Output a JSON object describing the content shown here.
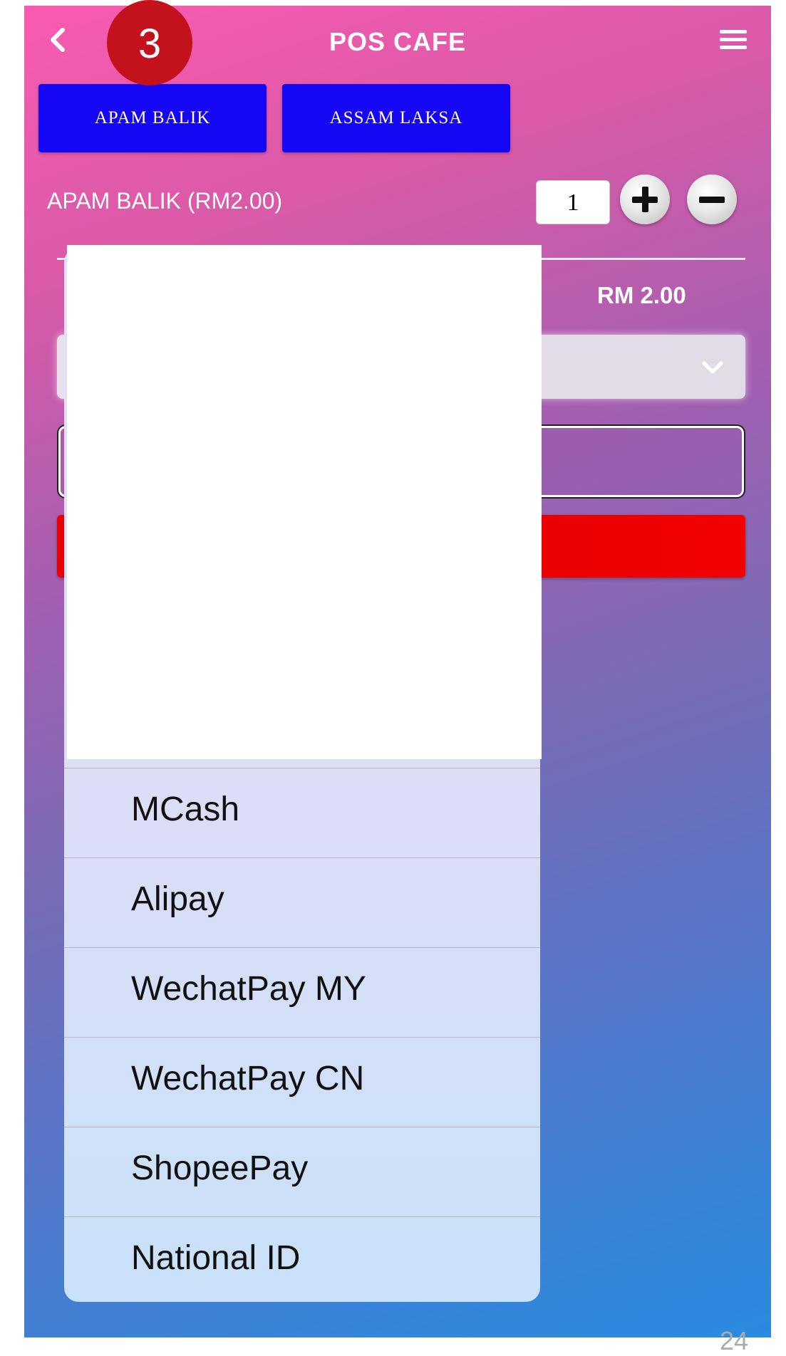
{
  "header": {
    "title": "POS CAFE",
    "back_icon": "chevron-left-icon",
    "menu_icon": "hamburger-menu-icon"
  },
  "step_badge": "3",
  "menu_items": [
    {
      "label": "APAM BALIK"
    },
    {
      "label": "ASSAM LAKSA"
    }
  ],
  "order": {
    "selected_item": "APAM BALIK (RM2.00)",
    "quantity": "1",
    "total": "RM 2.00"
  },
  "payment_dropdown": {
    "options": [
      {
        "label": "MCash"
      },
      {
        "label": "Alipay"
      },
      {
        "label": "WechatPay MY"
      },
      {
        "label": "WechatPay CN"
      },
      {
        "label": "ShopeePay"
      },
      {
        "label": "National ID"
      }
    ]
  },
  "colors": {
    "item_button": "#1507f4",
    "pay_button": "#e80000",
    "badge": "#c4121c"
  },
  "slide_number": "24"
}
